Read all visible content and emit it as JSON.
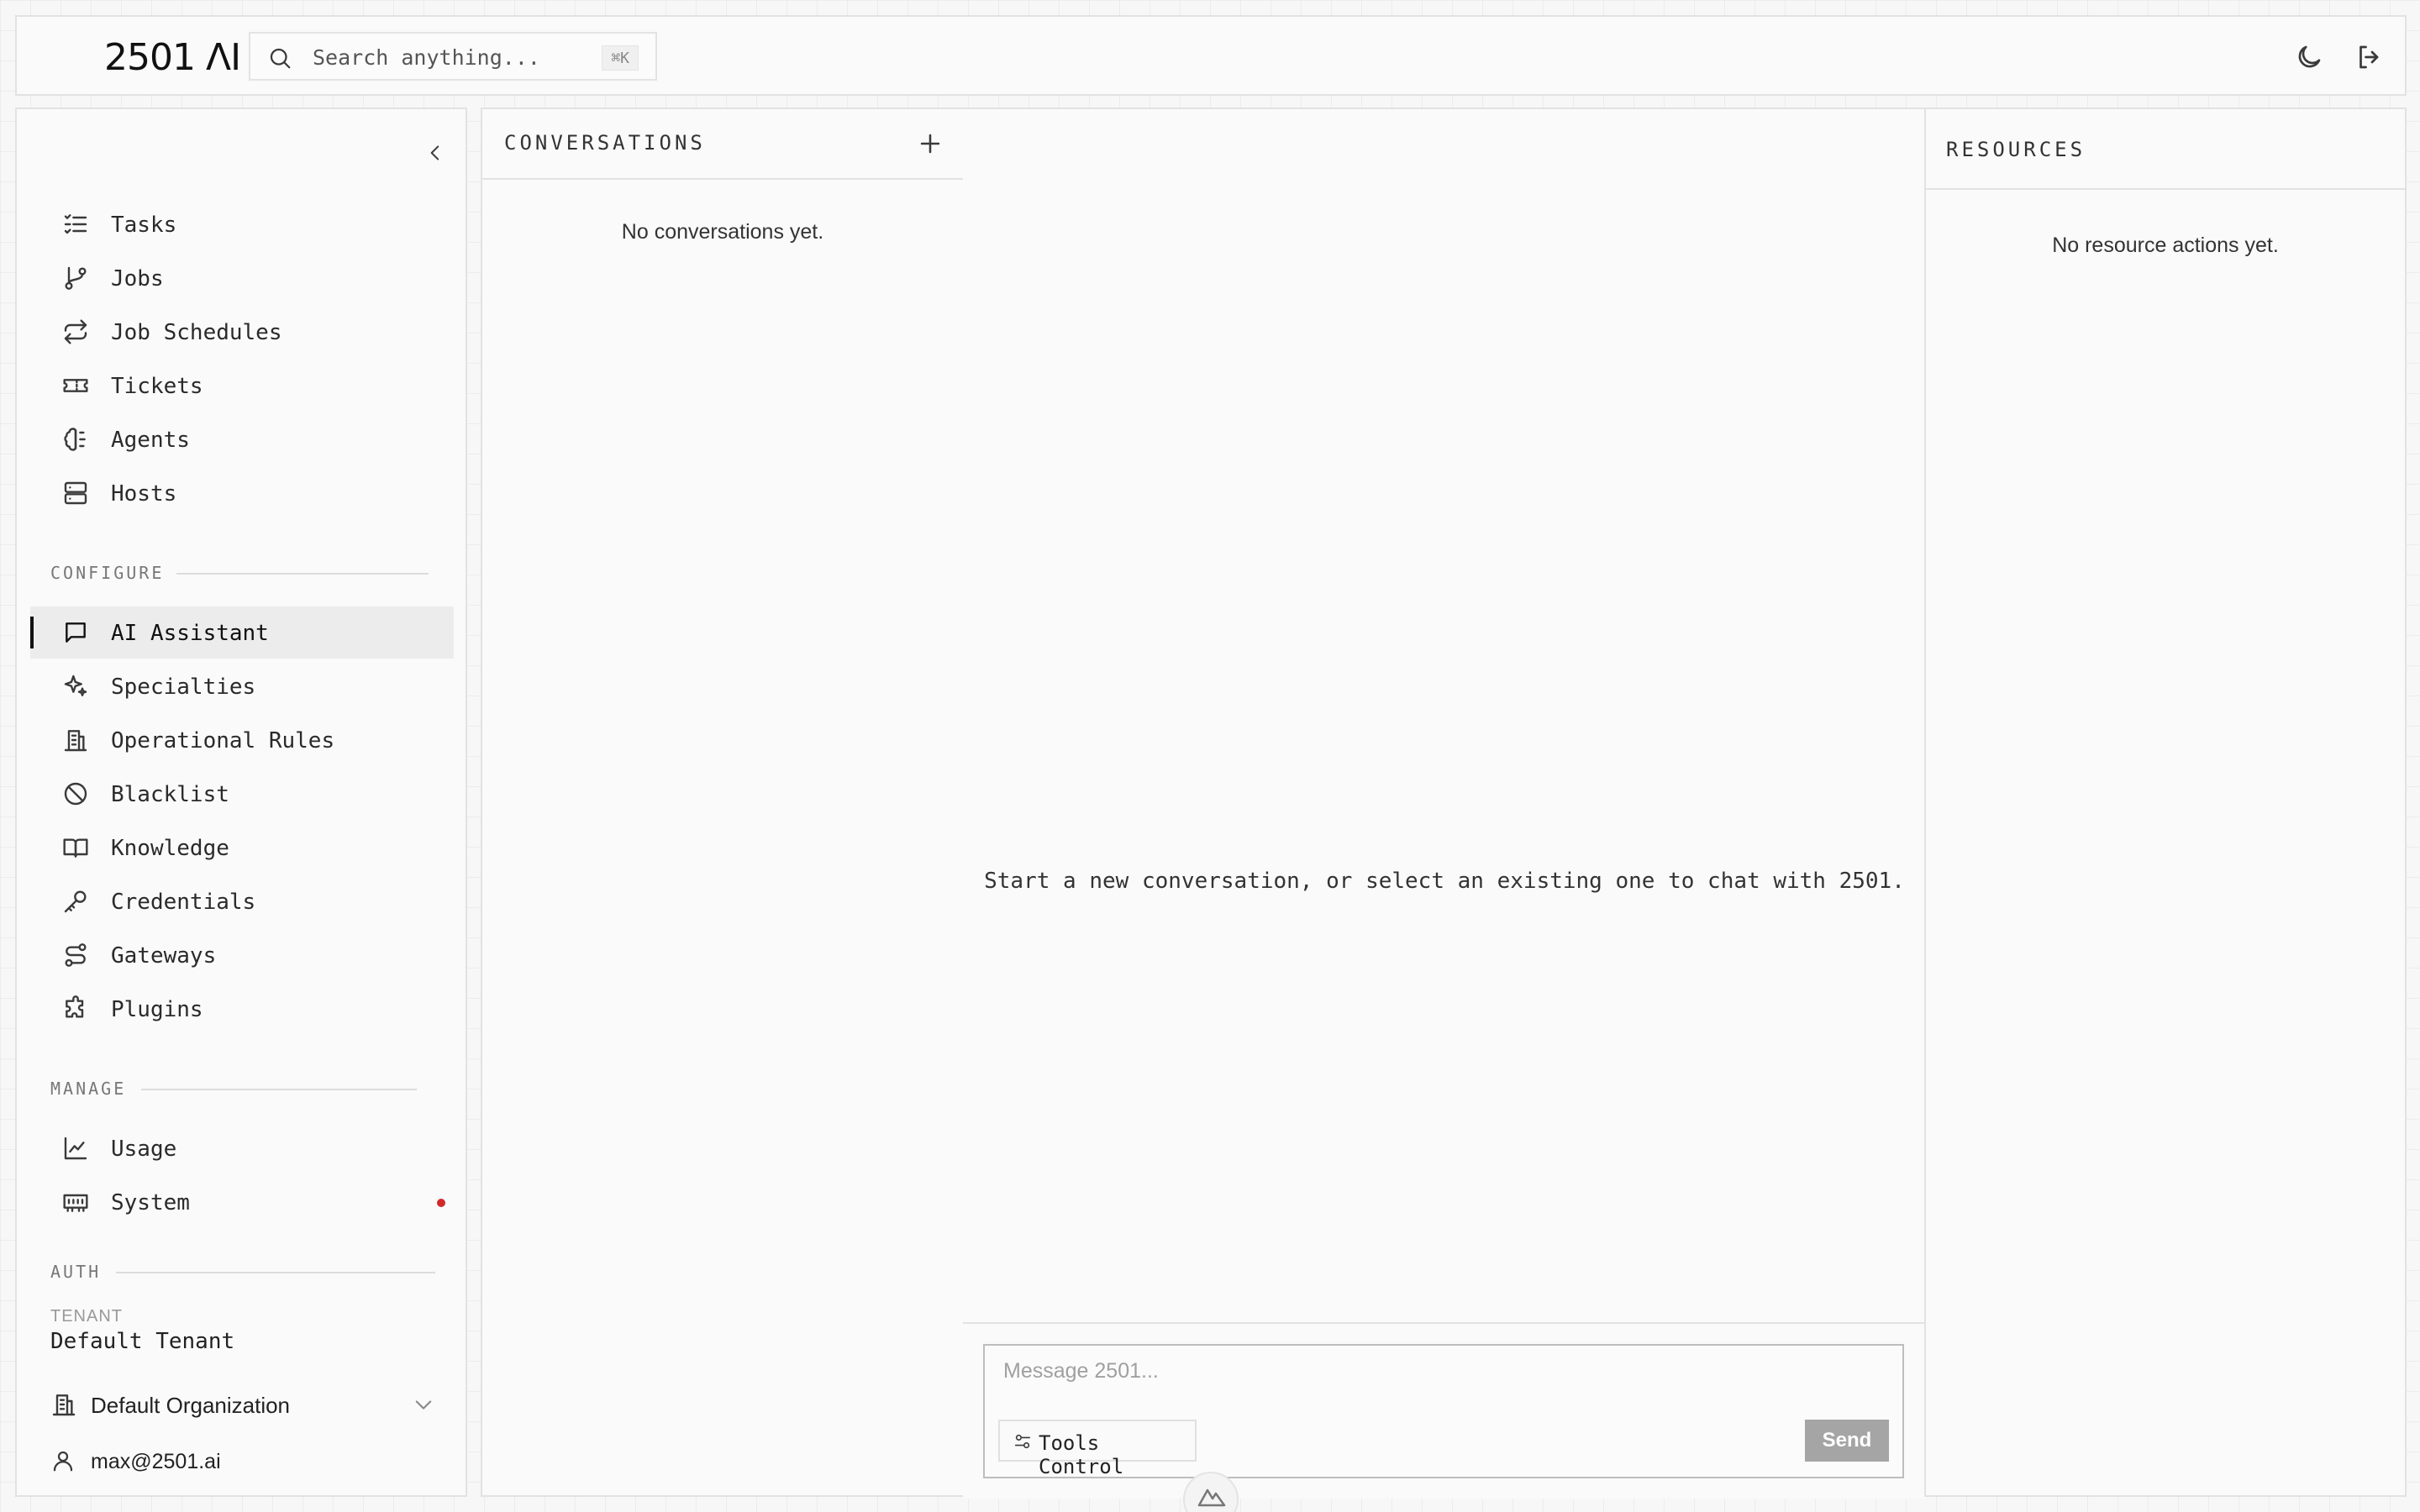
{
  "app": {
    "logo_text": "2501 ΛI",
    "search": {
      "placeholder": "Search anything...",
      "shortcut": "⌘K"
    }
  },
  "topbar": {
    "theme_icon": "moon-icon",
    "logout_icon": "logout-icon"
  },
  "sidebar": {
    "primary_items": [
      {
        "label": "Tasks",
        "icon": "list-check-icon"
      },
      {
        "label": "Jobs",
        "icon": "git-branch-icon"
      },
      {
        "label": "Job Schedules",
        "icon": "repeat-icon"
      },
      {
        "label": "Tickets",
        "icon": "ticket-icon"
      },
      {
        "label": "Agents",
        "icon": "brain-icon"
      },
      {
        "label": "Hosts",
        "icon": "server-icon"
      }
    ],
    "configure_label": "CONFIGURE",
    "configure_items": [
      {
        "label": "AI Assistant",
        "icon": "message-square-icon",
        "active": true
      },
      {
        "label": "Specialties",
        "icon": "sparkles-icon"
      },
      {
        "label": "Operational Rules",
        "icon": "building-icon"
      },
      {
        "label": "Blacklist",
        "icon": "ban-icon"
      },
      {
        "label": "Knowledge",
        "icon": "book-open-icon"
      },
      {
        "label": "Credentials",
        "icon": "key-icon"
      },
      {
        "label": "Gateways",
        "icon": "route-icon"
      },
      {
        "label": "Plugins",
        "icon": "puzzle-icon"
      }
    ],
    "manage_label": "MANAGE",
    "manage_items": [
      {
        "label": "Usage",
        "icon": "line-chart-icon"
      },
      {
        "label": "System",
        "icon": "memory-icon",
        "status_dot_color": "#d12a2a"
      }
    ],
    "auth_label": "AUTH",
    "tenant_label": "TENANT",
    "tenant_value": "Default Tenant",
    "organization": "Default Organization",
    "user_email": "max@2501.ai"
  },
  "conversations": {
    "title": "CONVERSATIONS",
    "empty_text": "No conversations yet."
  },
  "chat": {
    "empty_text": "Start a new conversation, or select an existing one to chat with 2501.",
    "input_placeholder": "Message 2501...",
    "tools_button": "Tools Control",
    "send_button": "Send"
  },
  "resources": {
    "title": "RESOURCES",
    "empty_text": "No resource actions yet."
  }
}
